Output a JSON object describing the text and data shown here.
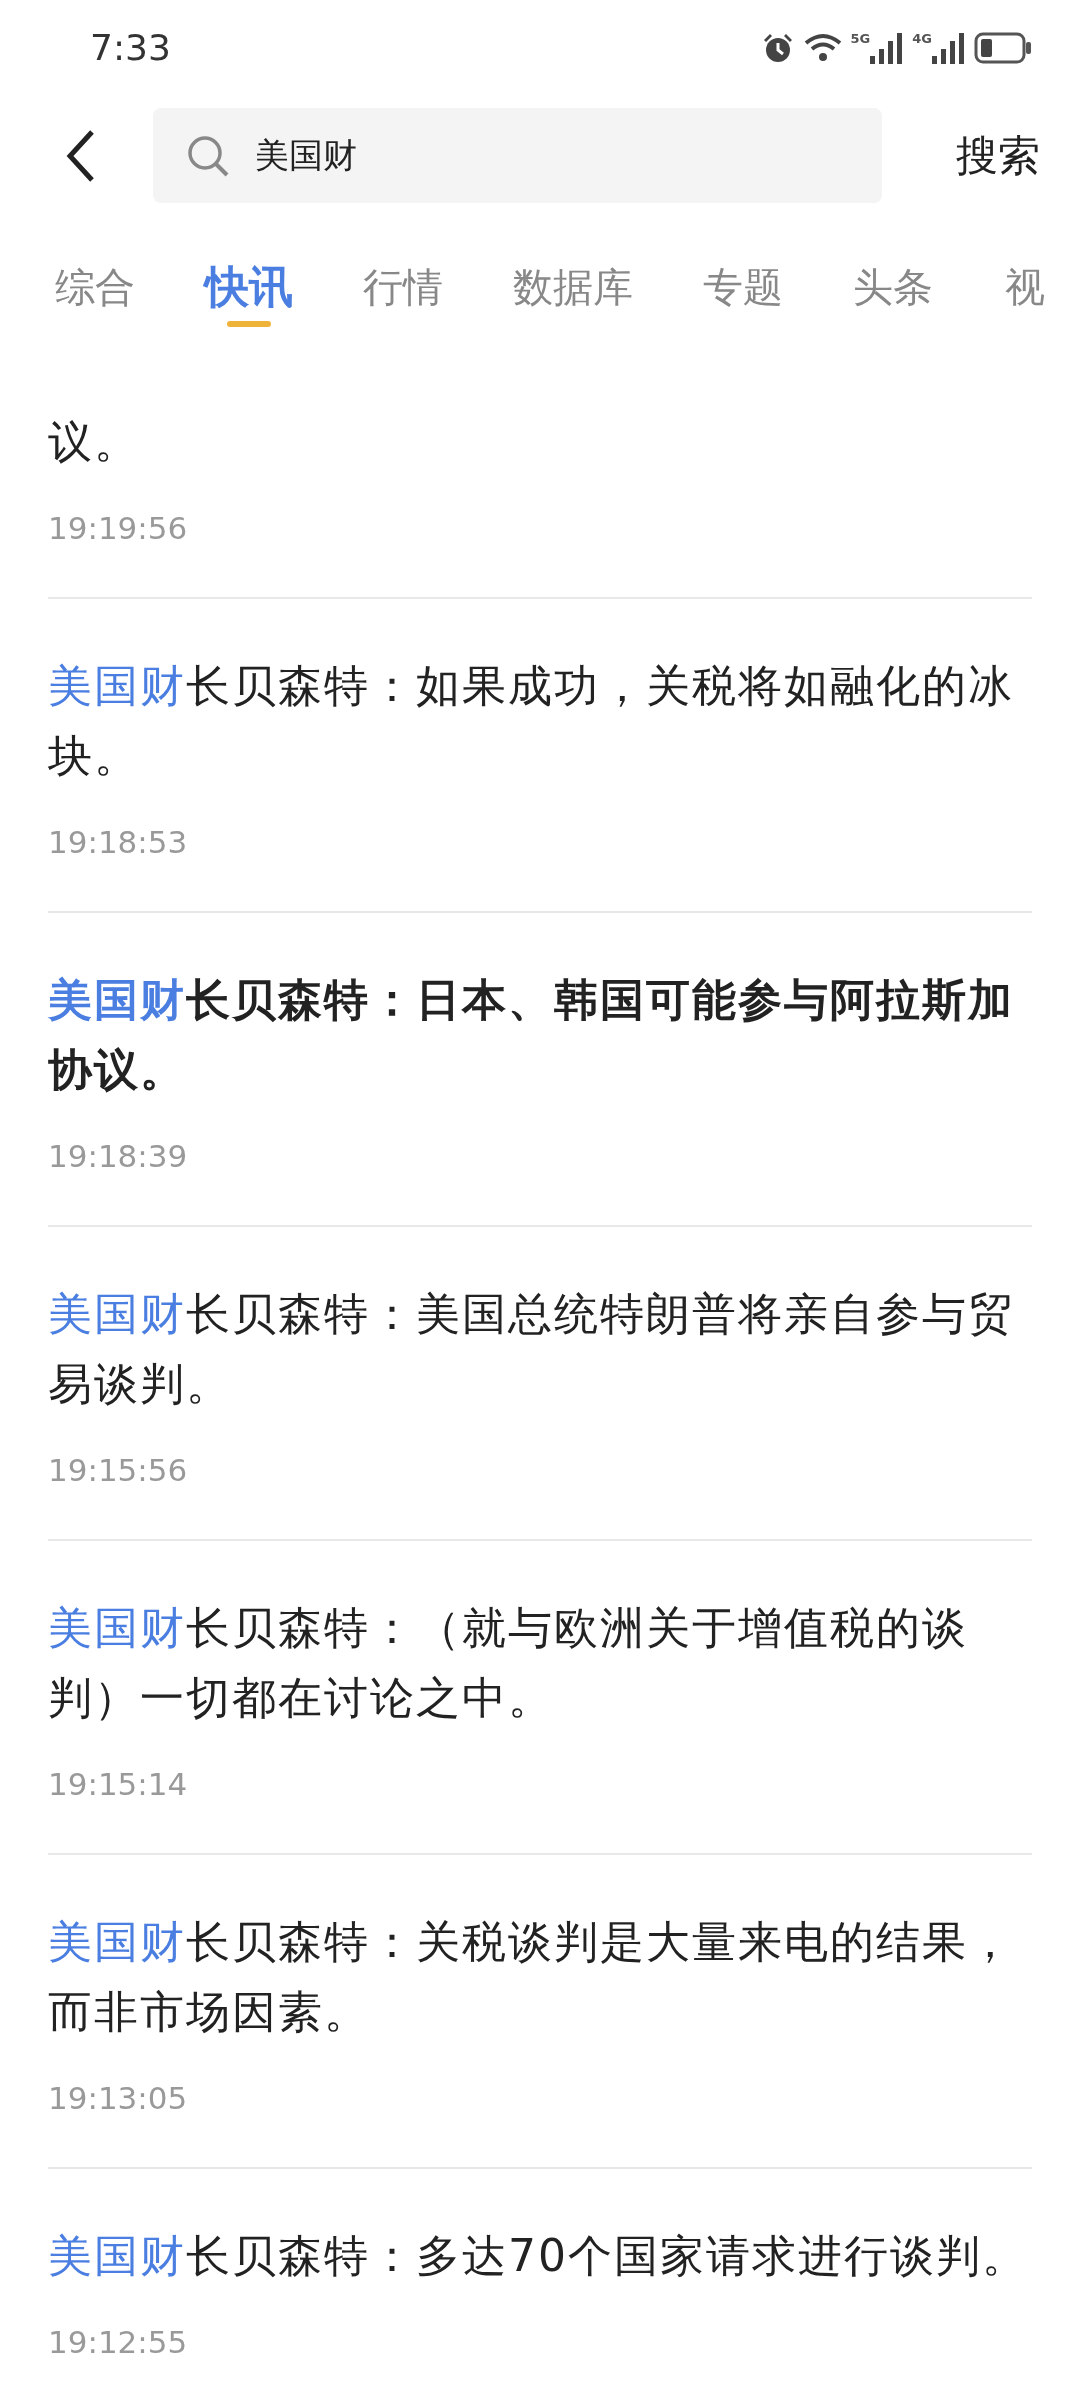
{
  "status_bar": {
    "time": "7:33",
    "network_1": "5G",
    "network_2": "4G"
  },
  "search": {
    "value": "美国财",
    "button": "搜索"
  },
  "tabs": [
    {
      "label": "综合",
      "selected": false
    },
    {
      "label": "快讯",
      "selected": true
    },
    {
      "label": "行情",
      "selected": false
    },
    {
      "label": "数据库",
      "selected": false
    },
    {
      "label": "专题",
      "selected": false
    },
    {
      "label": "头条",
      "selected": false
    },
    {
      "label": "视",
      "selected": false
    }
  ],
  "news": [
    {
      "text": "议。",
      "time": "19:19:56",
      "important": false
    },
    {
      "highlight": "美国财",
      "text": "长贝森特：如果成功，关税将如融化的冰块。",
      "time": "19:18:53",
      "important": false
    },
    {
      "highlight": "美国财",
      "text": "长贝森特：日本、韩国可能参与阿拉斯加协议。",
      "time": "19:18:39",
      "important": true
    },
    {
      "highlight": "美国财",
      "text": "长贝森特：美国总统特朗普将亲自参与贸易谈判。",
      "time": "19:15:56",
      "important": false
    },
    {
      "highlight": "美国财",
      "text": "长贝森特：（就与欧洲关于增值税的谈判）一切都在讨论之中。",
      "time": "19:15:14",
      "important": false
    },
    {
      "highlight": "美国财",
      "text": "长贝森特：关税谈判是大量来电的结果，而非市场因素。",
      "time": "19:13:05",
      "important": false
    },
    {
      "highlight": "美国财",
      "text": "长贝森特：多达70个国家请求进行谈判。",
      "time": "19:12:55",
      "important": false
    }
  ]
}
